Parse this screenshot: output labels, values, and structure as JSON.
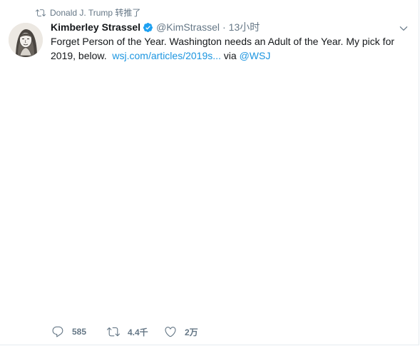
{
  "retweet_context": {
    "text": "Donald J. Trump 转推了"
  },
  "tweet": {
    "author_name": "Kimberley Strassel",
    "handle": "@KimStrassel",
    "separator": "·",
    "time": "13小时",
    "text_part1": "Forget Person of the Year. Washington needs an Adult of the Year. My pick for 2019, below.",
    "link_text": "wsj.com/articles/2019s...",
    "via_text": "via",
    "mention": "@WSJ"
  },
  "actions": {
    "reply_count": "585",
    "retweet_count": "4.4千",
    "like_count": "2万"
  },
  "icons": {
    "retweet": "retweet-icon",
    "verified": "verified-badge-icon",
    "caret": "chevron-down-icon",
    "reply": "reply-icon",
    "like": "heart-icon"
  },
  "colors": {
    "link": "#1b95e0",
    "secondary_text": "#657786",
    "primary_text": "#14171a",
    "verified_blue": "#1da1f2"
  }
}
